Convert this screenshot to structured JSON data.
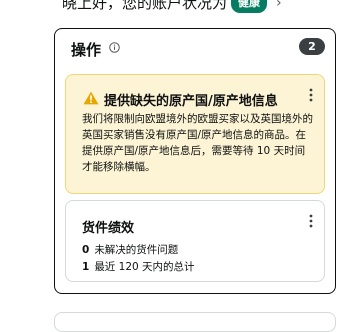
{
  "top": {
    "text": "晓上好，您的账户状况为",
    "badge": "健康",
    "chevron": "›"
  },
  "actions": {
    "title": "操作",
    "count": "2",
    "alert": {
      "title": "提供缺失的原产国/原产地信息",
      "body": "我们将限制向欧盟境外的欧盟买家以及英国境外的英国买家销售没有原产国/原产地信息的商品。在提供原产国/原产地信息后，需要等待 10 天时间才能移除横幅。"
    },
    "performance": {
      "title": "货件绩效",
      "rows": [
        {
          "num": "0",
          "label": "未解决的货件问题"
        },
        {
          "num": "1",
          "label": "最近 120 天内的总计"
        }
      ]
    }
  },
  "colors": {
    "badge": "#067d62",
    "alert_bg": "#fcf4d4",
    "alert_border": "#f0d775",
    "warn": "#e6a800",
    "pill": "#3b3f42"
  },
  "icons": {
    "info": "info-icon",
    "warning": "warning-icon",
    "more": "more-options-icon"
  }
}
